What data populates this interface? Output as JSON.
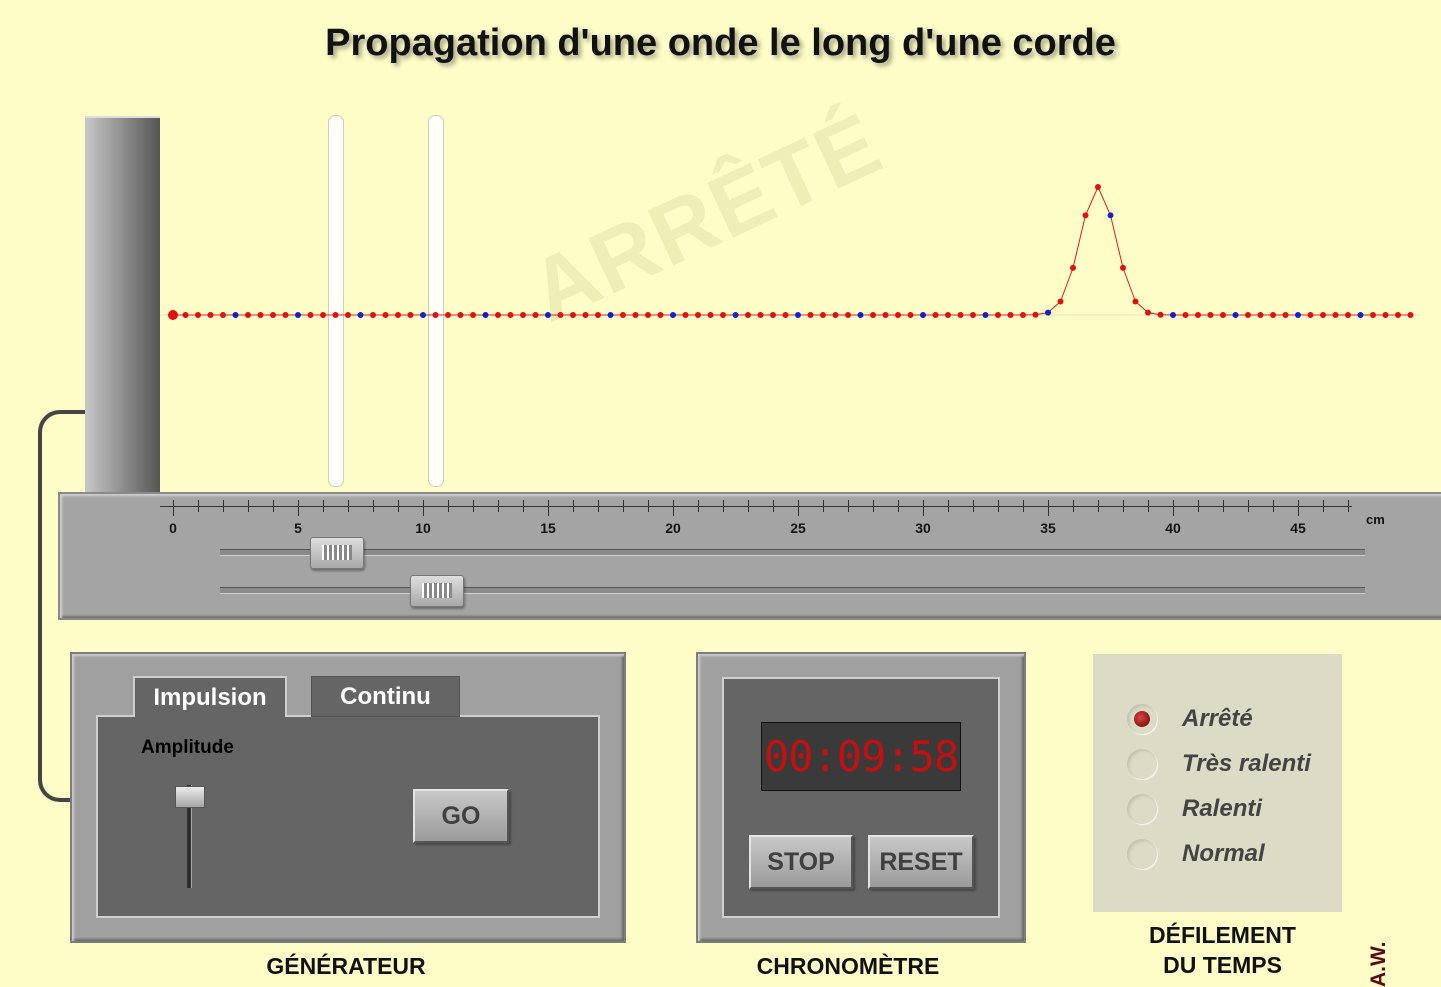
{
  "title": "Propagation d'une onde le long d'une corde",
  "watermark": "ARRÊTÉ",
  "ruler": {
    "unit": "cm",
    "labels": [
      "0",
      "5",
      "10",
      "15",
      "20",
      "25",
      "30",
      "35",
      "40",
      "45"
    ],
    "max_cm": 47
  },
  "probes_cm": [
    6.5,
    10.5
  ],
  "sliders_cm": [
    6.5,
    10.5
  ],
  "rope": {
    "bead_spacing_cm": 0.5,
    "count": 100,
    "marker_every": 5,
    "pulse_center_cm": 37,
    "pulse_amplitude": 1,
    "pulse_halfwidth_cm": 1.0,
    "colors": {
      "bead": "#e01010",
      "marker": "#1020d0",
      "line": "#e02020"
    }
  },
  "generator": {
    "tabs": [
      "Impulsion",
      "Continu"
    ],
    "active_tab": "Impulsion",
    "amplitude_label": "Amplitude",
    "go_label": "GO",
    "caption": "GÉNÉRATEUR"
  },
  "chrono": {
    "time": "00:09:58",
    "stop_label": "STOP",
    "reset_label": "RESET",
    "caption": "CHRONOMÈTRE"
  },
  "speed": {
    "options": [
      "Arrêté",
      "Très ralenti",
      "Ralenti",
      "Normal"
    ],
    "selected": "Arrêté",
    "caption_line1": "DÉFILEMENT",
    "caption_line2": "DU TEMPS"
  },
  "author": "A.W."
}
